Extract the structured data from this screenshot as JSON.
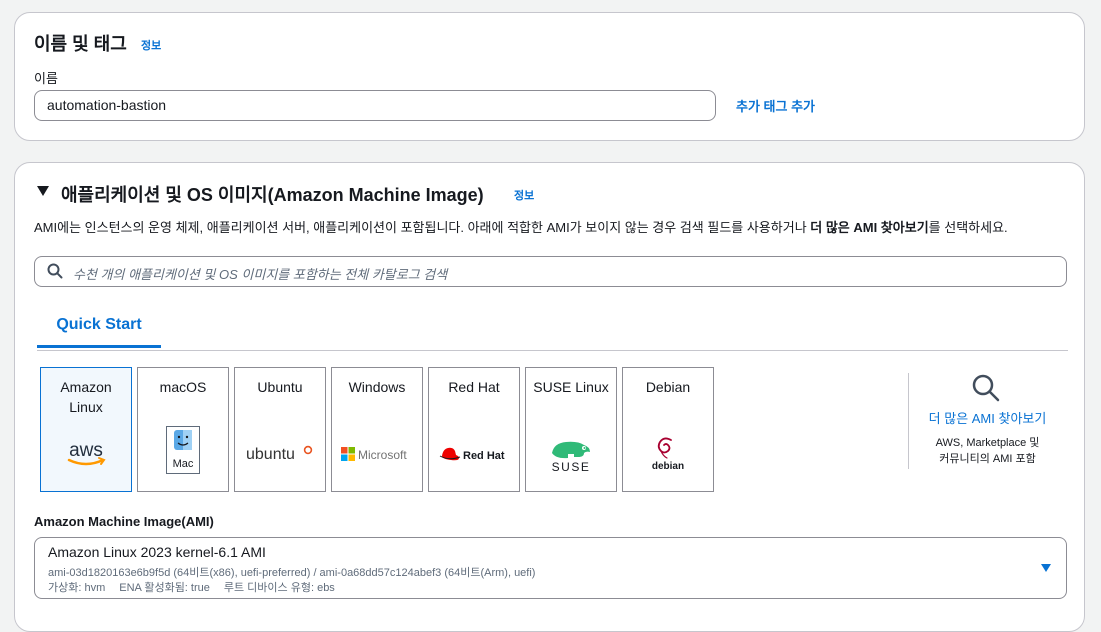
{
  "name_tags": {
    "title": "이름 및 태그",
    "info": "정보",
    "name_label": "이름",
    "name_value": "automation-bastion",
    "add_tags": "추가 태그 추가"
  },
  "ami_section": {
    "title": "애플리케이션 및 OS 이미지(Amazon Machine Image)",
    "info": "정보",
    "description_pre": "AMI에는 인스턴스의 운영 체제, 애플리케이션 서버, 애플리케이션이 포함됩니다. 아래에 적합한 AMI가 보이지 않는 경우 검색 필드를 사용하거나 ",
    "description_bold": "더 많은 AMI 찾아보기",
    "description_post": "를 선택하세요.",
    "search_placeholder": "수천 개의 애플리케이션 및 OS 이미지를 포함하는 전체 카탈로그 검색",
    "tab_label": "Quick Start",
    "tiles": [
      {
        "name": "Amazon Linux",
        "logo_text": "aws",
        "icon": "aws-logo",
        "selected": true
      },
      {
        "name": "macOS",
        "logo_text": "Mac",
        "icon": "mac-finder-logo",
        "selected": false
      },
      {
        "name": "Ubuntu",
        "logo_text": "ubuntu",
        "icon": "ubuntu-logo",
        "selected": false
      },
      {
        "name": "Windows",
        "logo_text": "Microsoft",
        "icon": "microsoft-logo",
        "selected": false
      },
      {
        "name": "Red Hat",
        "logo_text": "Red Hat",
        "icon": "redhat-logo",
        "selected": false
      },
      {
        "name": "SUSE Linux",
        "logo_text": "SUSE",
        "icon": "suse-logo",
        "selected": false
      },
      {
        "name": "Debian",
        "logo_text": "debian",
        "icon": "debian-logo",
        "selected": false
      }
    ],
    "browse_more_label": "더 많은 AMI 찾아보기",
    "browse_more_sub1": "AWS, Marketplace 및",
    "browse_more_sub2": "커뮤니티의 AMI 포함",
    "ami_label": "Amazon Machine Image(AMI)",
    "ami_selected_title": "Amazon Linux 2023 kernel-6.1 AMI",
    "ami_selected_ids": "ami-03d1820163e6b9f5d (64비트(x86), uefi-preferred) / ami-0a68dd57c124abef3 (64비트(Arm), uefi)",
    "ami_virtualization": "가상화: hvm",
    "ami_ena": "ENA 활성화됨: true",
    "ami_root_device": "루트 디바이스 유형: ebs"
  },
  "colors": {
    "link": "#0972d3",
    "border": "#8c8c94",
    "selected_bg": "#f2f8fd",
    "aws_orange": "#ff9900",
    "ubuntu_orange": "#e95420",
    "redhat_red": "#ee0000",
    "suse_green": "#30ba78",
    "debian_red": "#a80030"
  }
}
